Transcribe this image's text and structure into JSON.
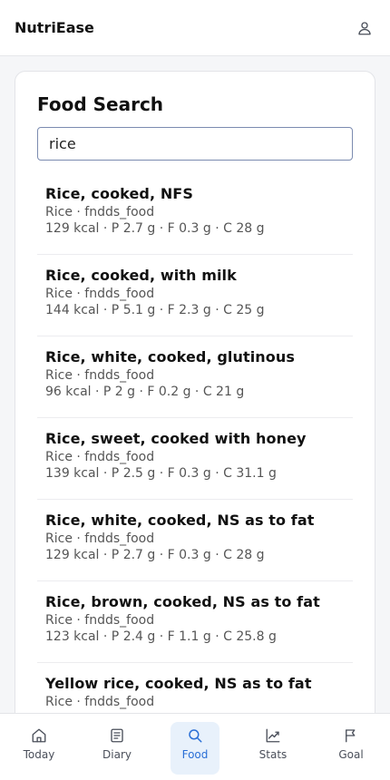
{
  "header": {
    "title": "NutriEase",
    "profile_icon": "user-icon"
  },
  "search": {
    "title": "Food Search",
    "query": "rice"
  },
  "results": [
    {
      "name": "Rice, cooked, NFS",
      "category": "Rice · fndds_food",
      "macros": "129 kcal · P 2.7 g · F 0.3 g · C 28 g"
    },
    {
      "name": "Rice, cooked, with milk",
      "category": "Rice · fndds_food",
      "macros": "144 kcal · P 5.1 g · F 2.3 g · C 25 g"
    },
    {
      "name": "Rice, white, cooked, glutinous",
      "category": "Rice · fndds_food",
      "macros": "96 kcal · P 2 g · F 0.2 g · C 21 g"
    },
    {
      "name": "Rice, sweet, cooked with honey",
      "category": "Rice · fndds_food",
      "macros": "139 kcal · P 2.5 g · F 0.3 g · C 31.1 g"
    },
    {
      "name": "Rice, white, cooked, NS as to fat",
      "category": "Rice · fndds_food",
      "macros": "129 kcal · P 2.7 g · F 0.3 g · C 28 g"
    },
    {
      "name": "Rice, brown, cooked, NS as to fat",
      "category": "Rice · fndds_food",
      "macros": "123 kcal · P 2.4 g · F 1.1 g · C 25.8 g"
    },
    {
      "name": "Yellow rice, cooked, NS as to fat",
      "category": "Rice · fndds_food",
      "macros": ""
    }
  ],
  "nav": {
    "items": [
      {
        "label": "Today",
        "icon": "home-icon"
      },
      {
        "label": "Diary",
        "icon": "notebook-icon"
      },
      {
        "label": "Food",
        "icon": "search-icon",
        "active": true
      },
      {
        "label": "Stats",
        "icon": "trend-chart-icon"
      },
      {
        "label": "Goal",
        "icon": "flag-icon"
      }
    ]
  },
  "colors": {
    "accent": "#2a6fd6",
    "active_bg": "#e8f1fb"
  }
}
